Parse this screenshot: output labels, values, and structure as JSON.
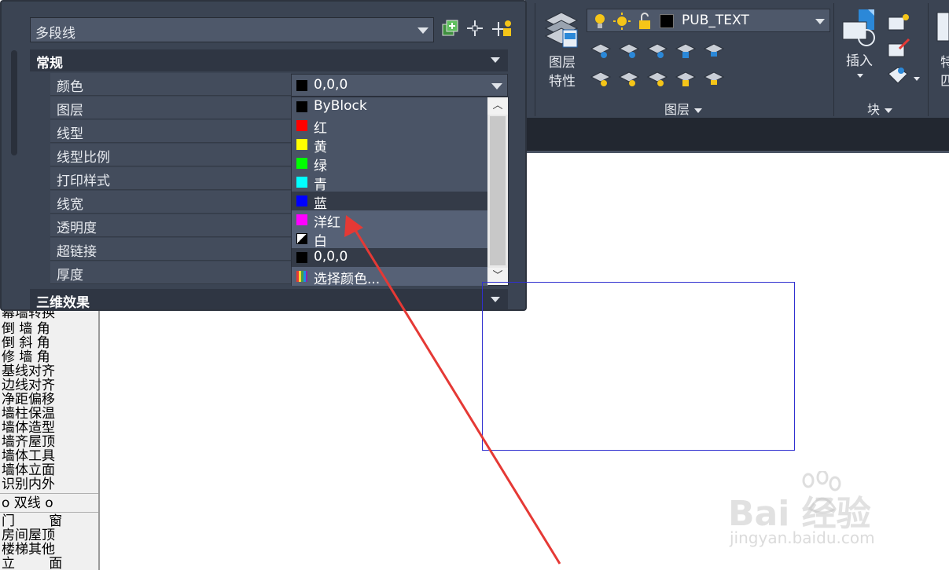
{
  "palette": {
    "object_type": "多段线",
    "section_general": "常规",
    "section_3d": "三维效果",
    "properties": [
      "颜色",
      "图层",
      "线型",
      "线型比例",
      "打印样式",
      "线宽",
      "透明度",
      "超链接",
      "厚度"
    ],
    "color_value": "0,0,0",
    "color_options": [
      {
        "label": "ByBlock",
        "color": "#000000"
      },
      {
        "label": "红",
        "color": "#ff0000"
      },
      {
        "label": "黄",
        "color": "#ffff00"
      },
      {
        "label": "绿",
        "color": "#00ff00"
      },
      {
        "label": "青",
        "color": "#00ffff"
      },
      {
        "label": "蓝",
        "color": "#0000ff"
      },
      {
        "label": "洋红",
        "color": "#ff00ff"
      },
      {
        "label": "白",
        "color": "#ffffff"
      },
      {
        "label": "0,0,0",
        "color": "#000000"
      },
      {
        "label": "选择颜色...",
        "color": "#7fb2d9"
      }
    ]
  },
  "ribbon": {
    "layer_properties_line1": "图层",
    "layer_properties_line2": "特性",
    "current_layer": "PUB_TEXT",
    "layer_panel_title": "图层",
    "insert_label": "插入",
    "block_panel_title": "块",
    "cut_label_1": "特",
    "cut_label_2": "匹"
  },
  "left_menu": {
    "items_a": [
      "幕墙转换",
      "倒 墙 角",
      "倒 斜 角",
      "修 墙 角",
      "基线对齐",
      "边线对齐",
      "净距偏移",
      "墙柱保温",
      "墙体造型",
      "墙齐屋顶",
      "墙体工具",
      "墙体立面",
      "识别内外"
    ],
    "header": "o 双线 o",
    "items_b": [
      "门        窗",
      "房间屋顶",
      "楼梯其他",
      "立        面"
    ]
  },
  "watermark": {
    "brand": "Bai 经验",
    "url": "jingyan.baidu.com"
  },
  "colors": {
    "palette_bg": "#3b4453",
    "annotation_arrow": "#e53935",
    "polyline": "#3030d0"
  }
}
